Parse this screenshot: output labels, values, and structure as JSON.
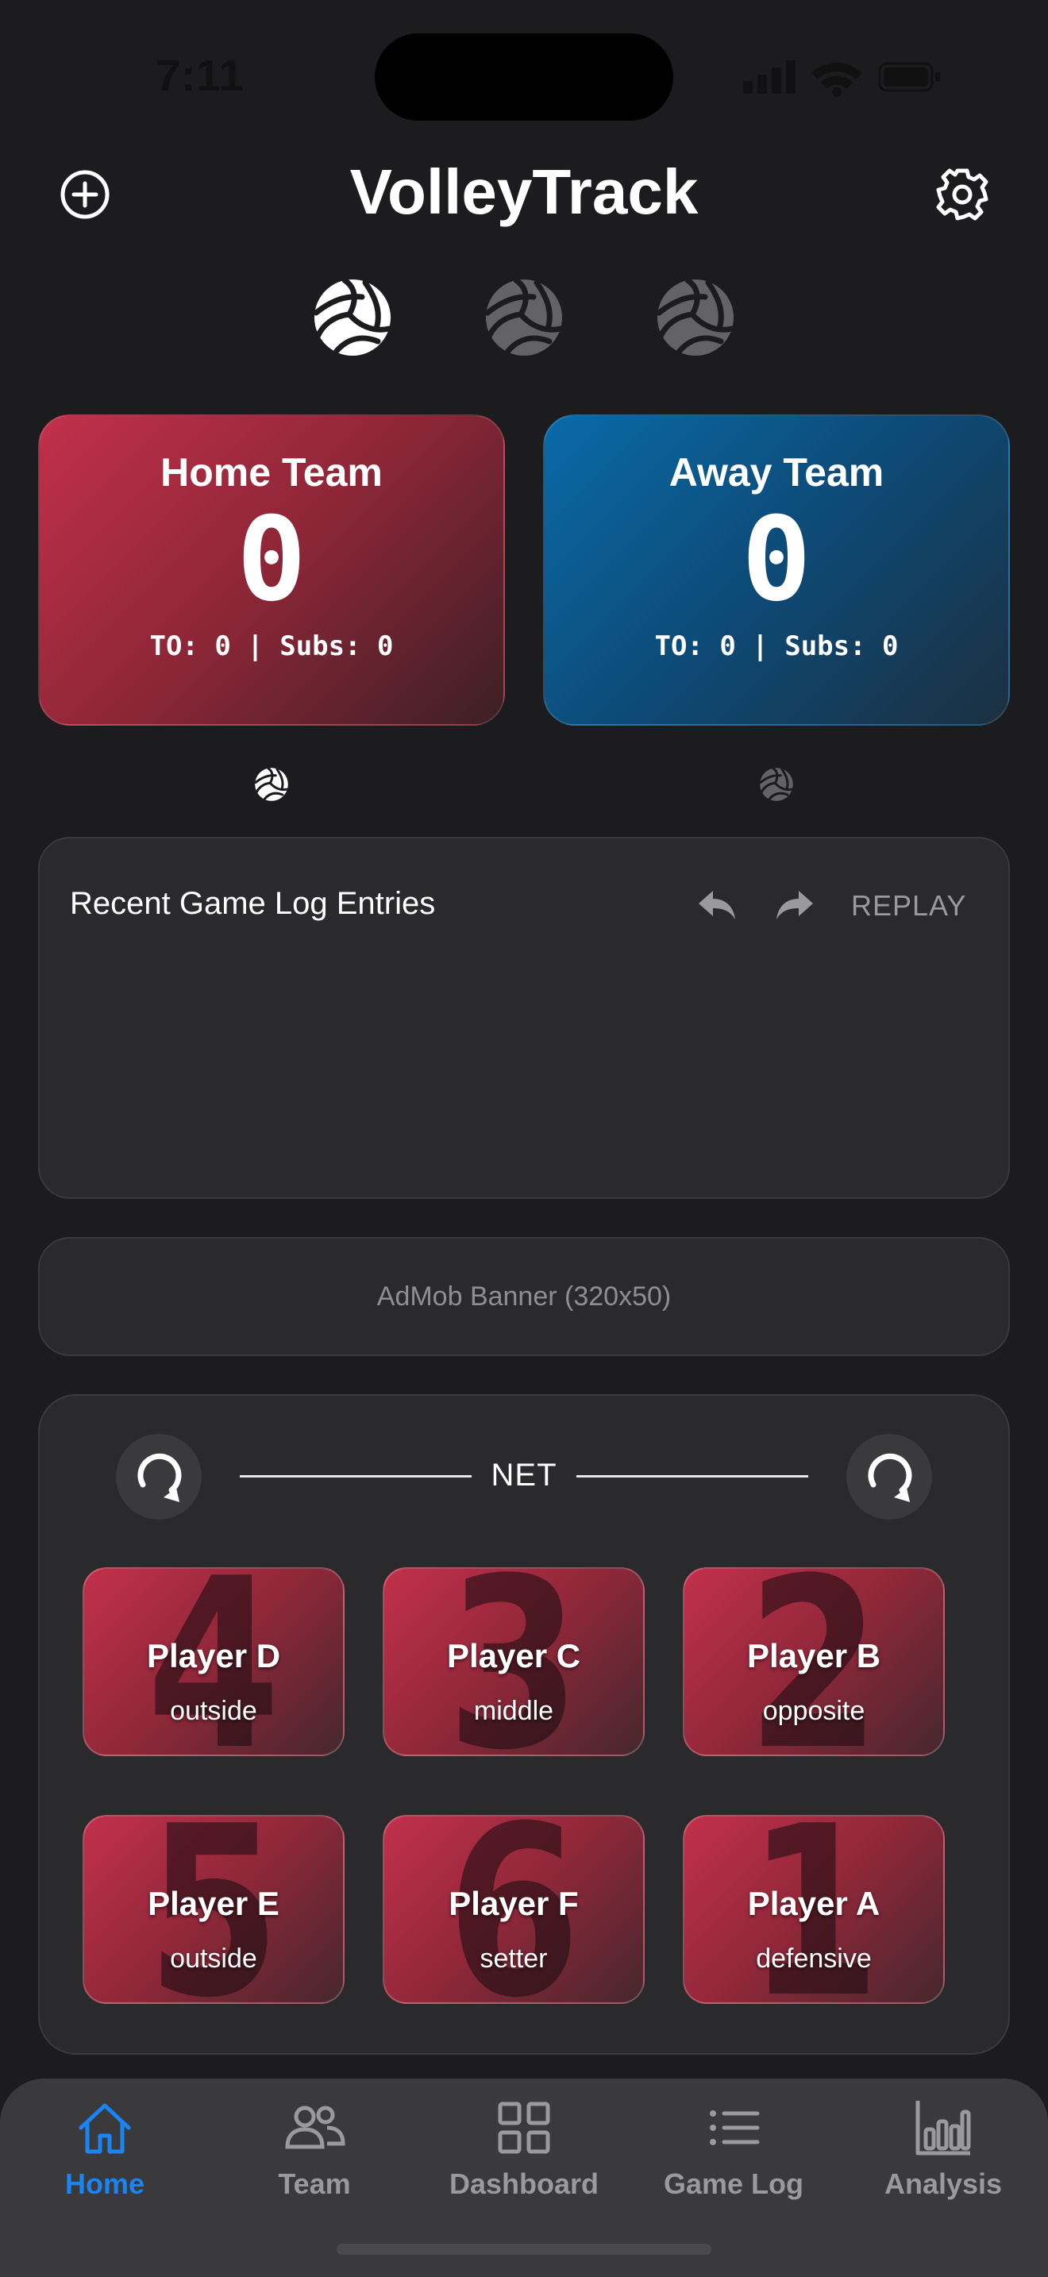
{
  "status_bar": {
    "time": "7:11"
  },
  "header": {
    "title": "VolleyTrack",
    "add_icon": "plus-circle-icon",
    "settings_icon": "gear-icon"
  },
  "sets": {
    "won_icon": "volleyball-icon",
    "total": 3,
    "active": 1
  },
  "teams": {
    "home": {
      "name": "Home Team",
      "score": "0",
      "stats": "TO: 0 | Subs: 0",
      "color": "#c2304b",
      "serving": true
    },
    "away": {
      "name": "Away Team",
      "score": "0",
      "stats": "TO: 0 | Subs: 0",
      "color": "#0a6aa8",
      "serving": false
    }
  },
  "game_log": {
    "title": "Recent Game Log Entries",
    "undo_icon": "undo-arrow-icon",
    "redo_icon": "redo-arrow-icon",
    "replay_label": "REPLAY",
    "entries": []
  },
  "ad": {
    "label": "AdMob Banner (320x50)"
  },
  "court": {
    "net_label": "NET",
    "rotate_icon": "rotate-icon",
    "front_row": [
      {
        "number": "4",
        "name": "Player D",
        "role": "outside"
      },
      {
        "number": "3",
        "name": "Player C",
        "role": "middle"
      },
      {
        "number": "2",
        "name": "Player B",
        "role": "opposite"
      }
    ],
    "back_row": [
      {
        "number": "5",
        "name": "Player E",
        "role": "outside"
      },
      {
        "number": "6",
        "name": "Player F",
        "role": "setter"
      },
      {
        "number": "1",
        "name": "Player A",
        "role": "defensive"
      }
    ]
  },
  "tabbar": {
    "accent": "#1a84f2",
    "items": [
      {
        "label": "Home",
        "icon": "home-icon",
        "active": true
      },
      {
        "label": "Team",
        "icon": "people-icon",
        "active": false
      },
      {
        "label": "Dashboard",
        "icon": "grid-icon",
        "active": false
      },
      {
        "label": "Game Log",
        "icon": "list-icon",
        "active": false
      },
      {
        "label": "Analysis",
        "icon": "bar-chart-icon",
        "active": false
      }
    ]
  }
}
